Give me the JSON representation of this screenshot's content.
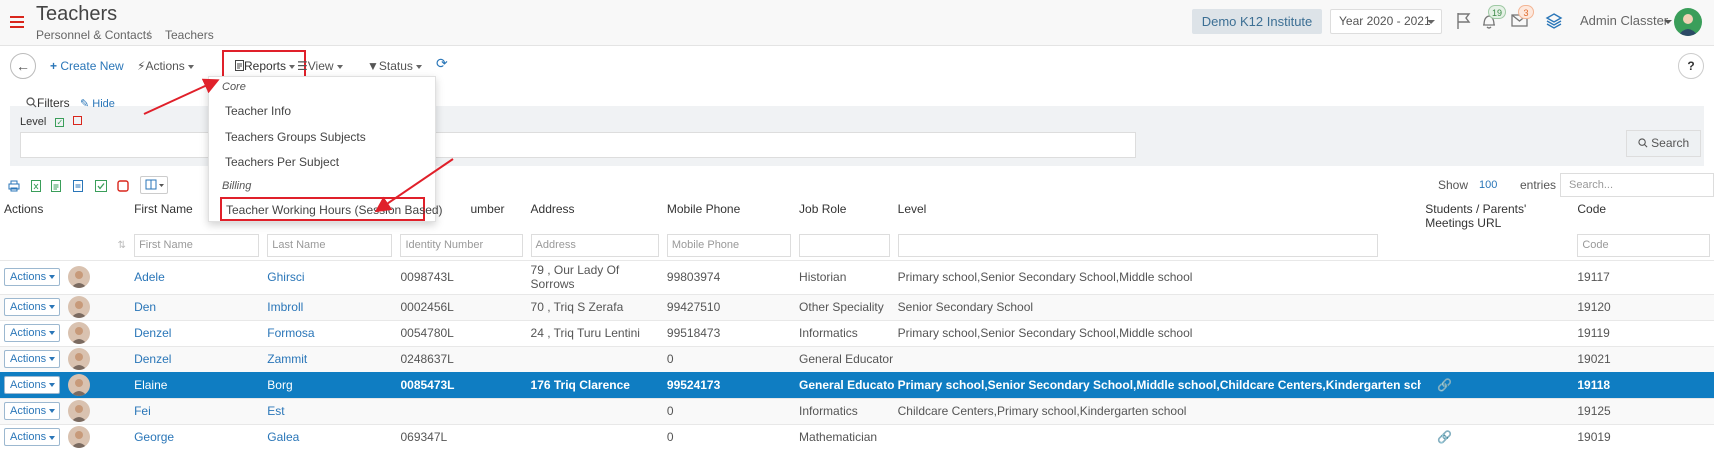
{
  "header": {
    "title": "Teachers",
    "breadcrumb": [
      "Personnel & Contacts",
      "Teachers"
    ],
    "breadcrumb_sep": "/",
    "institute": "Demo K12 Institute",
    "year": "Year 2020 - 2021",
    "notifications_count": "19",
    "messages_count": "3",
    "user": "Admin Classter",
    "accent": "#d9261c"
  },
  "toolbar": {
    "create_new": "Create New",
    "actions": "Actions",
    "reports": "Reports",
    "view": "View",
    "status": "Status",
    "help": "?"
  },
  "reports_menu": {
    "core_header": "Core",
    "core_items": [
      "Teacher Info",
      "Teachers Groups Subjects",
      "Teachers Per Subject"
    ],
    "billing_header": "Billing",
    "billing_items": [
      "Teacher Working Hours (Session Based)"
    ]
  },
  "filters": {
    "title": "Filters",
    "hide": "Hide",
    "level_label": "Level",
    "search_button": "Search"
  },
  "table_controls": {
    "show": "Show",
    "page_size": "100",
    "entries": "entries",
    "search_placeholder": "Search..."
  },
  "columns": {
    "actions": "Actions",
    "first_name": "First Name",
    "identity_number_visible": "umber",
    "address": "Address",
    "mobile_phone": "Mobile Phone",
    "job_role": "Job Role",
    "level": "Level",
    "meetings_url_1": "Students / Parents'",
    "meetings_url_2": "Meetings URL",
    "code": "Code"
  },
  "filter_placeholders": {
    "first_name": "First Name",
    "last_name": "Last Name",
    "identity_number": "Identity Number",
    "address": "Address",
    "mobile_phone": "Mobile Phone",
    "code": "Code"
  },
  "row_action_label": "Actions",
  "rows": [
    {
      "first": "Adele",
      "last": "Ghirsci",
      "id": "0098743L",
      "addr1": "79 , Our Lady Of",
      "addr2": "Sorrows",
      "phone": "99803974",
      "job": "Historian",
      "level": "Primary school,Senior Secondary School,Middle school",
      "code": "19117"
    },
    {
      "first": "Den",
      "last": "Imbroll",
      "id": "0002456L",
      "addr1": "70 , Triq S Zerafa",
      "addr2": "",
      "phone": "99427510",
      "job": "Other Speciality",
      "level": "Senior Secondary School",
      "code": "19120"
    },
    {
      "first": "Denzel",
      "last": "Formosa",
      "id": "0054780L",
      "addr1": "24 , Triq Turu Lentini",
      "addr2": "",
      "phone": "99518473",
      "job": "Informatics",
      "level": "Primary school,Senior Secondary School,Middle school",
      "code": "19119"
    },
    {
      "first": "Denzel",
      "last": "Zammit",
      "id": "0248637L",
      "addr1": "",
      "addr2": "",
      "phone": "0",
      "job": "General Educator",
      "level": "",
      "code": "19021"
    },
    {
      "first": "Elaine",
      "last": "Borg",
      "id": "0085473L",
      "addr1": "176 Triq Clarence",
      "addr2": "",
      "phone": "99524173",
      "job": "General Educator",
      "level": "Primary school,Senior Secondary School,Middle school,Childcare Centers,Kindergarten school",
      "code": "19118"
    },
    {
      "first": "Fei",
      "last": "Est",
      "id": "",
      "addr1": "",
      "addr2": "",
      "phone": "0",
      "job": "Informatics",
      "level": "Childcare Centers,Primary school,Kindergarten school",
      "code": "19125"
    },
    {
      "first": "George",
      "last": "Galea",
      "id": "069347L",
      "addr1": "",
      "addr2": "",
      "phone": "0",
      "job": "Mathematician",
      "level": "",
      "code": "19019"
    }
  ]
}
